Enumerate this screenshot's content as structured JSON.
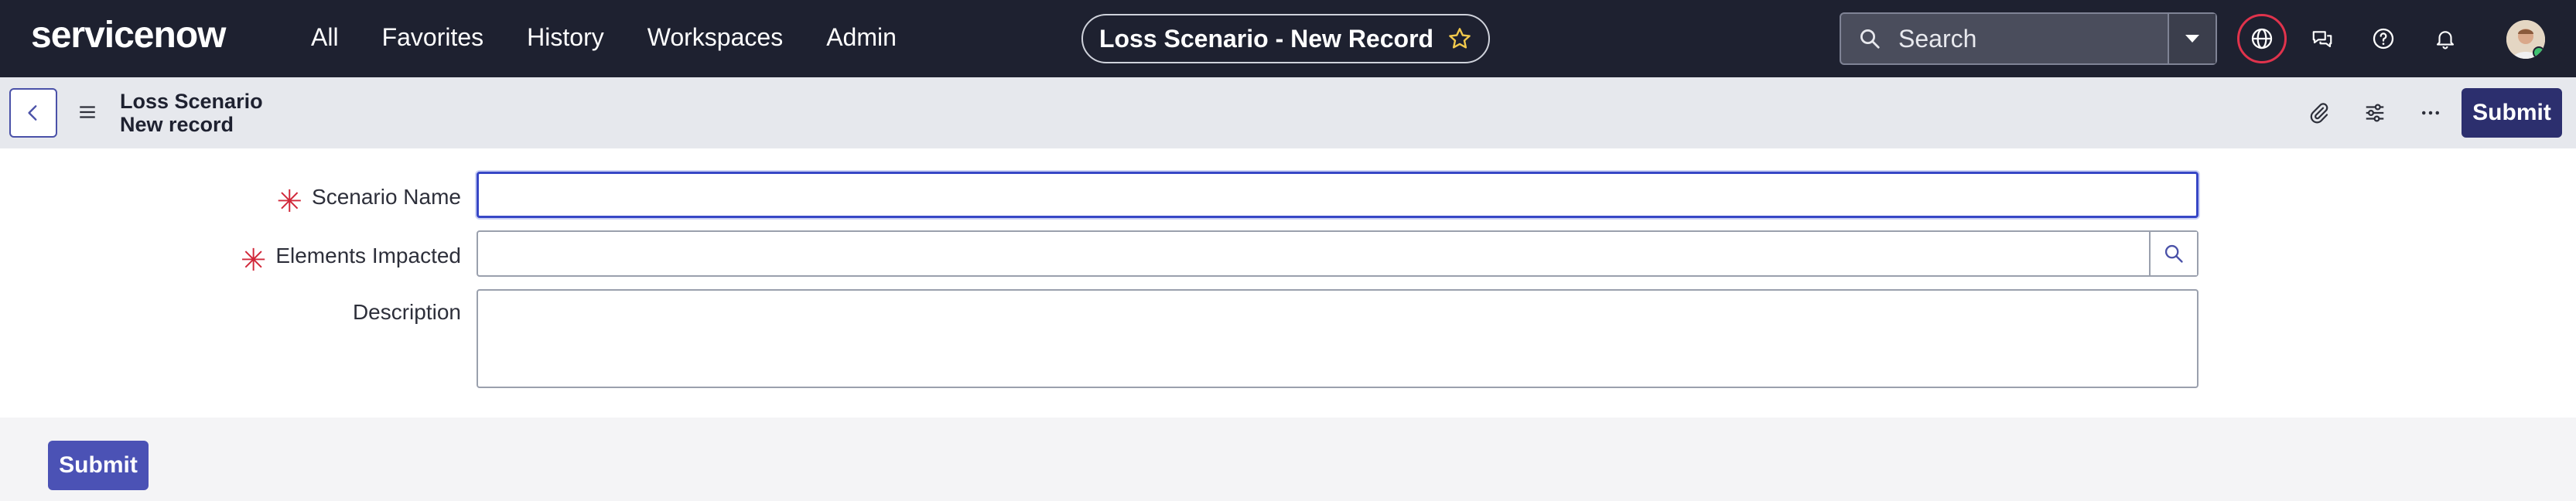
{
  "topnav": {
    "logo": "servicenow",
    "links": [
      "All",
      "Favorites",
      "History",
      "Workspaces",
      "Admin"
    ],
    "record_title": "Loss Scenario - New Record",
    "search_placeholder": "Search"
  },
  "record_header": {
    "title_line1": "Loss Scenario",
    "title_line2": "New record",
    "submit_label": "Submit"
  },
  "form": {
    "fields": [
      {
        "label": "Scenario Name",
        "required": true,
        "value": ""
      },
      {
        "label": "Elements Impacted",
        "required": true,
        "value": ""
      },
      {
        "label": "Description",
        "required": false,
        "value": ""
      }
    ],
    "required_marker": "✳"
  },
  "footer": {
    "submit_label": "Submit"
  },
  "colors": {
    "nav_bg": "#1e2130",
    "accent": "#2c2f6e",
    "submit_bottom": "#4b52b5",
    "required": "#d1283a",
    "focus": "#3747c6"
  }
}
